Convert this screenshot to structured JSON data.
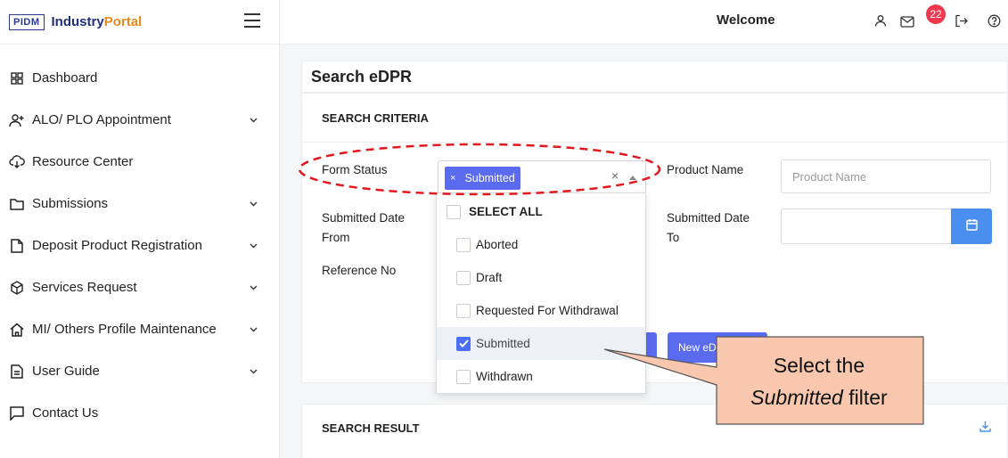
{
  "brand": {
    "logo": "PIDM",
    "name_part1": "Industry",
    "name_part2": "Portal"
  },
  "header": {
    "welcome": "Welcome",
    "notification_count": "22"
  },
  "sidebar": {
    "items": [
      {
        "label": "Dashboard",
        "icon": "grid-icon",
        "has_children": false
      },
      {
        "label": "ALO/ PLO Appointment",
        "icon": "user-plus-icon",
        "has_children": true
      },
      {
        "label": "Resource Center",
        "icon": "cloud-download-icon",
        "has_children": false
      },
      {
        "label": "Submissions",
        "icon": "folder-icon",
        "has_children": true
      },
      {
        "label": "Deposit Product Registration",
        "icon": "document-icon",
        "has_children": true
      },
      {
        "label": "Services Request",
        "icon": "cube-icon",
        "has_children": true
      },
      {
        "label": "MI/ Others Profile Maintenance",
        "icon": "home-icon",
        "has_children": true
      },
      {
        "label": "User Guide",
        "icon": "file-text-icon",
        "has_children": true
      },
      {
        "label": "Contact Us",
        "icon": "message-icon",
        "has_children": false
      }
    ]
  },
  "page": {
    "title": "Search eDPR",
    "criteria_title": "SEARCH CRITERIA",
    "result_title": "SEARCH RESULT"
  },
  "form": {
    "form_status_label": "Form Status",
    "form_status_selected": "Submitted",
    "product_name_label": "Product Name",
    "product_name_placeholder": "Product Name",
    "submitted_from_label_1": "Submitted Date",
    "submitted_from_label_2": "From",
    "submitted_to_label_1": "Submitted Date",
    "submitted_to_label_2": "To",
    "reference_no_label": "Reference No",
    "new_button_label": "New eD"
  },
  "dropdown": {
    "select_all": "SELECT ALL",
    "options": [
      {
        "label": "Aborted",
        "checked": false
      },
      {
        "label": "Draft",
        "checked": false
      },
      {
        "label": "Requested For Withdrawal",
        "checked": false
      },
      {
        "label": "Submitted",
        "checked": true
      },
      {
        "label": "Withdrawn",
        "checked": false
      }
    ]
  },
  "callout": {
    "line1": "Select the",
    "line2_italic": "Submitted",
    "line2_rest": " filter"
  },
  "colors": {
    "accent": "#5b6bf0",
    "calendar_button": "#4a8ff0",
    "badge": "#f2384f",
    "highlight_ellipse": "#e0191e",
    "callout_fill": "#f8c7ae"
  }
}
